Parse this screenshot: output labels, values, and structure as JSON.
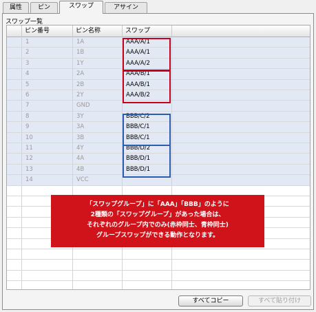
{
  "tabs": [
    {
      "label": "属性"
    },
    {
      "label": "ピン"
    },
    {
      "label": "スワップ"
    },
    {
      "label": "アサイン"
    }
  ],
  "section_title": "スワップ一覧",
  "columns": [
    "ピン番号",
    "ピン名称",
    "スワップ"
  ],
  "rows": [
    {
      "num": "1",
      "name": "1A",
      "swap": "AAA/A/1"
    },
    {
      "num": "2",
      "name": "1B",
      "swap": "AAA/A/1"
    },
    {
      "num": "3",
      "name": "1Y",
      "swap": "AAA/A/2"
    },
    {
      "num": "4",
      "name": "2A",
      "swap": "AAA/B/1"
    },
    {
      "num": "5",
      "name": "2B",
      "swap": "AAA/B/1"
    },
    {
      "num": "6",
      "name": "2Y",
      "swap": "AAA/B/2"
    },
    {
      "num": "7",
      "name": "GND",
      "swap": ""
    },
    {
      "num": "8",
      "name": "3Y",
      "swap": "BBB/C/2"
    },
    {
      "num": "9",
      "name": "3A",
      "swap": "BBB/C/1"
    },
    {
      "num": "10",
      "name": "3B",
      "swap": "BBB/C/1"
    },
    {
      "num": "11",
      "name": "4Y",
      "swap": "BBB/D/2"
    },
    {
      "num": "12",
      "name": "4A",
      "swap": "BBB/D/1"
    },
    {
      "num": "13",
      "name": "4B",
      "swap": "BBB/D/1"
    },
    {
      "num": "14",
      "name": "VCC",
      "swap": ""
    }
  ],
  "notice": {
    "line1": "「スワップグループ」に「AAA」「BBB」のように",
    "line2": "2種類の「スワップグループ」があった場合は、",
    "line3": "それぞれのグループ内でのみ(赤枠同士、青枠同士)",
    "line4": "グループスワップができる動作となります。"
  },
  "buttons": {
    "copy_all": "すべてコピー",
    "paste_all": "すべて貼り付け"
  },
  "colors": {
    "group_red": "#c8001a",
    "group_blue": "#2a5db0",
    "notice_bg": "#d0131b",
    "row_fill": "#e3e8f5"
  }
}
